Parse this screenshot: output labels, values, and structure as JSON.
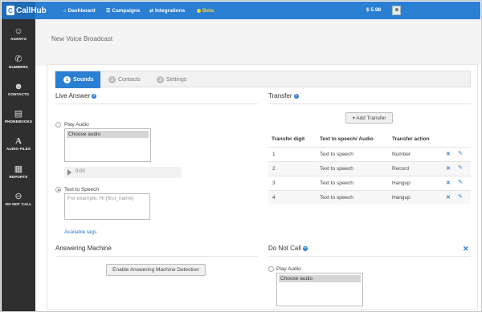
{
  "app": {
    "logo_letter": "C",
    "name": "CallHub"
  },
  "topnav": {
    "items": [
      {
        "icon": "⌂",
        "label": "Dashboard"
      },
      {
        "icon": "☰",
        "label": "Campaigns"
      },
      {
        "icon": "⇄",
        "label": "Integrations"
      }
    ],
    "beta_label": "Beta",
    "balance": "$ 5.98"
  },
  "sidebar": {
    "items": [
      {
        "icon": "☺",
        "label": "AGENTS"
      },
      {
        "icon": "✆",
        "label": "NUMBERS"
      },
      {
        "icon": "☻",
        "label": "CONTACTS"
      },
      {
        "icon": "▤",
        "label": "PHONEBOOKS"
      },
      {
        "icon": "A",
        "label": "AUDIO FILES"
      },
      {
        "icon": "▦",
        "label": "REPORTS"
      },
      {
        "icon": "⊖",
        "label": "DO NOT CALL"
      }
    ]
  },
  "page": {
    "title": "New Voice Broadcast"
  },
  "tabs": [
    {
      "num": "1",
      "label": "Sounds",
      "active": true
    },
    {
      "num": "2",
      "label": "Contacts",
      "active": false
    },
    {
      "num": "3",
      "label": "Settings",
      "active": false
    }
  ],
  "live_answer": {
    "title": "Live Answer",
    "help": "?",
    "play_audio_label": "Play Audio",
    "choose_audio": "Choose audio",
    "audio_time": "0:00",
    "tts_label": "Text to Speech",
    "tts_placeholder": "For example: Hi {first_name}",
    "available_tags": "Available tags"
  },
  "transfer": {
    "title": "Transfer",
    "help": "?",
    "add_button": "Add Transfer",
    "add_plus": "+",
    "headers": [
      "Transfer digit",
      "Text to speech/ Audio",
      "Transfer action"
    ],
    "rows": [
      {
        "digit": "1",
        "audio": "Text to speech",
        "action": "Number"
      },
      {
        "digit": "2",
        "audio": "Text to speech",
        "action": "Record"
      },
      {
        "digit": "3",
        "audio": "Text to speech",
        "action": "Hangup"
      },
      {
        "digit": "4",
        "audio": "Text to speech",
        "action": "Hangup"
      }
    ],
    "delete_icon": "✕",
    "edit_icon": "✎"
  },
  "answering_machine": {
    "title": "Answering Machine",
    "button": "Enable Answering Machine Detection"
  },
  "do_not_call": {
    "title": "Do Not Call",
    "help": "?",
    "close_icon": "✕",
    "play_audio_label": "Play Audio",
    "choose_audio": "Choose audio"
  },
  "colors": {
    "accent": "#2a7fd2",
    "sidebar": "#2f2f2f",
    "beta": "#f5d33a"
  }
}
